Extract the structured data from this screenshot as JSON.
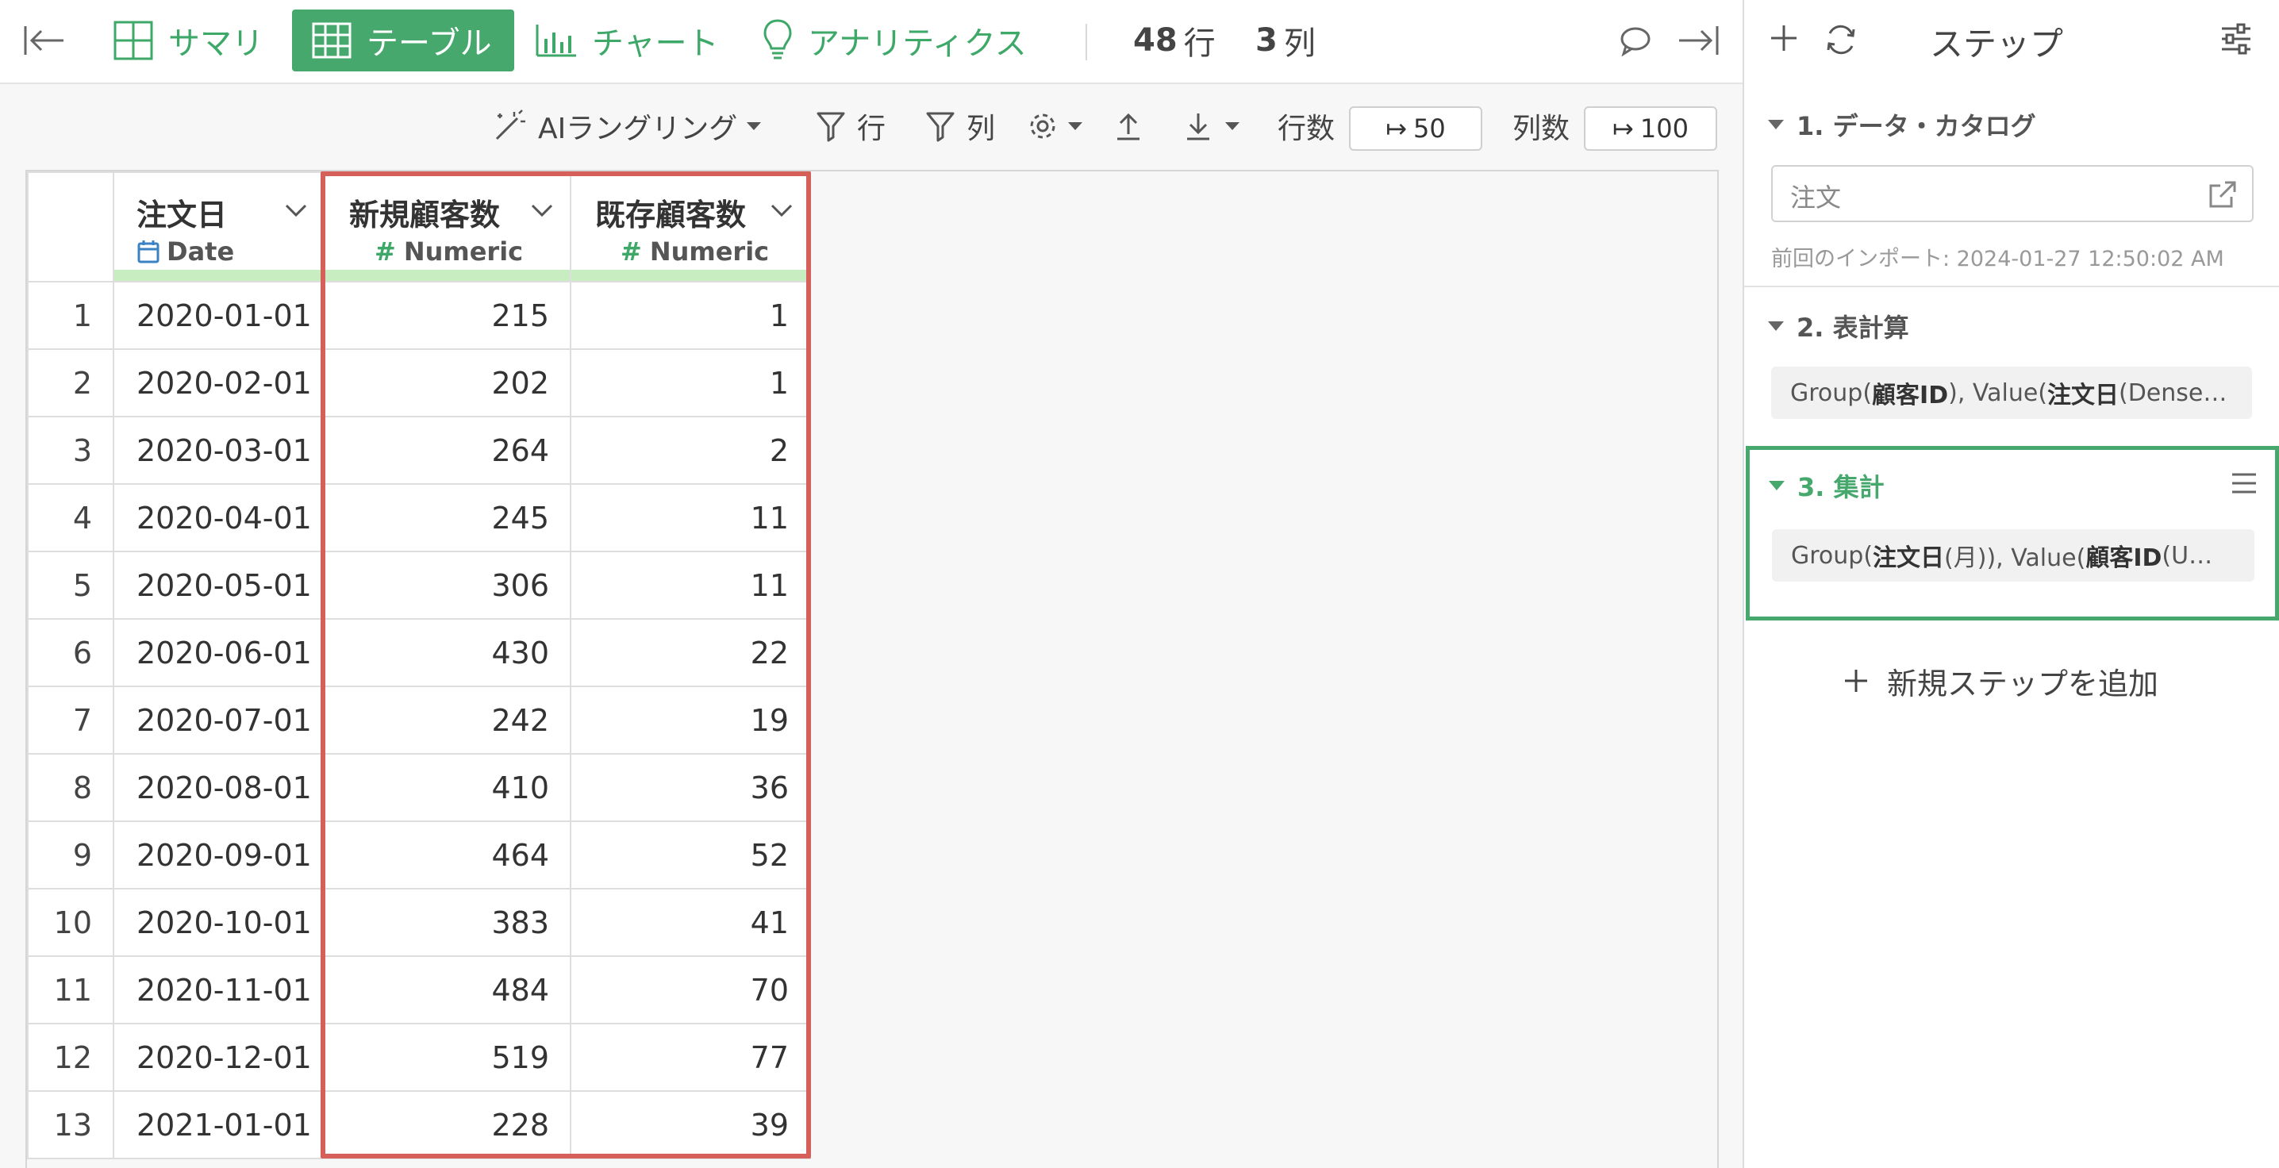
{
  "topbar": {
    "tabs": [
      {
        "label": "サマリ"
      },
      {
        "label": "テーブル"
      },
      {
        "label": "チャート"
      },
      {
        "label": "アナリティクス"
      }
    ],
    "rows_count": "48",
    "rows_unit": "行",
    "cols_count": "3",
    "cols_unit": "列"
  },
  "toolbar": {
    "ai_wrangling": "AIラングリング",
    "filter_rows": "行",
    "filter_cols": "列",
    "rows_label": "行数",
    "rows_value": "50",
    "cols_label": "列数",
    "cols_value": "100"
  },
  "table": {
    "columns": [
      {
        "name": "注文日",
        "type": "Date"
      },
      {
        "name": "新規顧客数",
        "type": "Numeric"
      },
      {
        "name": "既存顧客数",
        "type": "Numeric"
      }
    ],
    "rows": [
      {
        "n": "1",
        "date": "2020-01-01",
        "new": "215",
        "existing": "1"
      },
      {
        "n": "2",
        "date": "2020-02-01",
        "new": "202",
        "existing": "1"
      },
      {
        "n": "3",
        "date": "2020-03-01",
        "new": "264",
        "existing": "2"
      },
      {
        "n": "4",
        "date": "2020-04-01",
        "new": "245",
        "existing": "11"
      },
      {
        "n": "5",
        "date": "2020-05-01",
        "new": "306",
        "existing": "11"
      },
      {
        "n": "6",
        "date": "2020-06-01",
        "new": "430",
        "existing": "22"
      },
      {
        "n": "7",
        "date": "2020-07-01",
        "new": "242",
        "existing": "19"
      },
      {
        "n": "8",
        "date": "2020-08-01",
        "new": "410",
        "existing": "36"
      },
      {
        "n": "9",
        "date": "2020-09-01",
        "new": "464",
        "existing": "52"
      },
      {
        "n": "10",
        "date": "2020-10-01",
        "new": "383",
        "existing": "41"
      },
      {
        "n": "11",
        "date": "2020-11-01",
        "new": "484",
        "existing": "70"
      },
      {
        "n": "12",
        "date": "2020-12-01",
        "new": "519",
        "existing": "77"
      },
      {
        "n": "13",
        "date": "2021-01-01",
        "new": "228",
        "existing": "39"
      }
    ]
  },
  "side": {
    "title": "ステップ",
    "steps": [
      {
        "title": "1. データ・カタログ",
        "source": "注文",
        "note": "前回のインポート: 2024-01-27 12:50:02 AM"
      },
      {
        "title": "2. 表計算",
        "p1": "Group(",
        "b1": "顧客ID",
        "p2": "), Value(",
        "b2": "注文日",
        "p3": " (Dense…"
      },
      {
        "title": "3. 集計",
        "p1": "Group(",
        "b1": "注文日",
        "p2": " (月)), Value(",
        "b2": "顧客ID",
        "p3": " (U…"
      }
    ],
    "add_step": "新規ステップを追加"
  },
  "colors": {
    "accent": "#46a86c",
    "highlight": "#d5605a",
    "type_bar": "#c8edc0"
  }
}
